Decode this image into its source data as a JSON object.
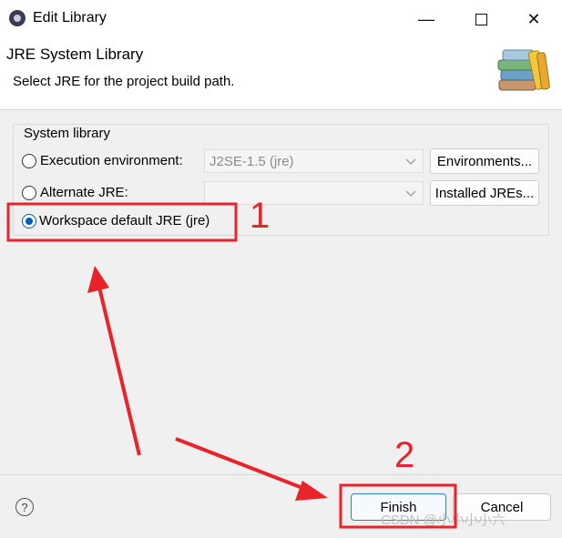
{
  "window": {
    "title": "Edit Library",
    "min_glyph": "—",
    "close_glyph": "✕"
  },
  "header": {
    "title": "JRE System Library",
    "subtitle": "Select JRE for the project build path."
  },
  "system_library": {
    "group_label": "System library",
    "options": [
      {
        "label": "Execution environment:",
        "checked": false
      },
      {
        "label": "Alternate JRE:",
        "checked": false
      },
      {
        "label": "Workspace default JRE (jre)",
        "checked": true
      }
    ],
    "execution_environment_value": "J2SE-1.5 (jre)",
    "alternate_jre_value": "",
    "environments_button": "Environments...",
    "installed_jres_button": "Installed JREs..."
  },
  "footer": {
    "help_glyph": "?",
    "finish_button": "Finish",
    "cancel_button": "Cancel"
  },
  "annotations": {
    "step1": "1",
    "step2": "2",
    "color": "#e8232a"
  },
  "watermark": "CSDN @小小小小六",
  "colors": {
    "accent": "#005fb8",
    "finish_border": "#2f7fd0",
    "annotation_red": "#e8232a"
  }
}
